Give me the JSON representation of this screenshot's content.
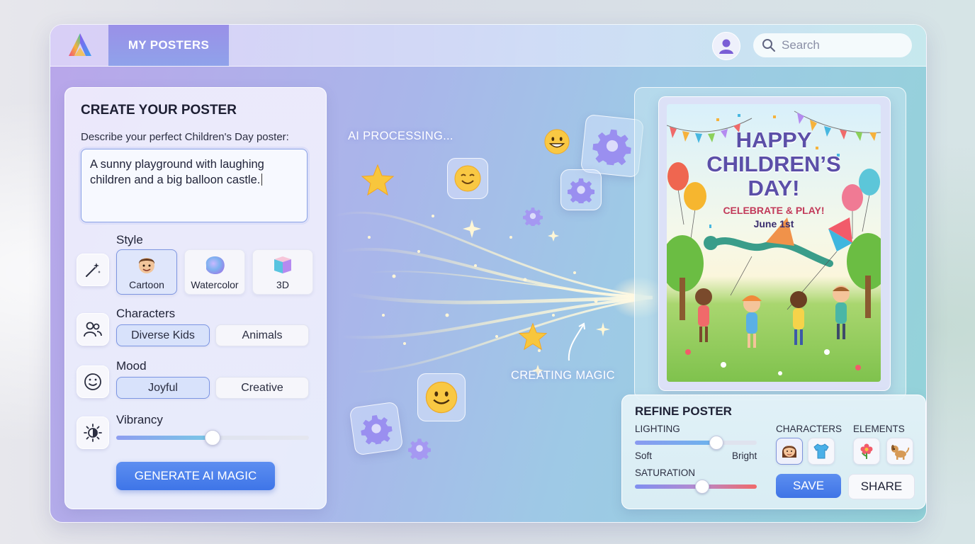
{
  "topbar": {
    "tab_label": "MY POSTERS",
    "search_placeholder": "Search"
  },
  "create": {
    "title": "CREATE YOUR POSTER",
    "describe_label": "Describe your perfect Children's Day poster:",
    "prompt_text": "A sunny playground with laughing children and a big balloon castle.",
    "style": {
      "label": "Style",
      "options": [
        "Cartoon",
        "Watercolor",
        "3D"
      ],
      "selected": "Cartoon"
    },
    "characters": {
      "label": "Characters",
      "options": [
        "Diverse Kids",
        "Animals"
      ],
      "selected": "Diverse Kids"
    },
    "mood": {
      "label": "Mood",
      "options": [
        "Joyful",
        "Creative"
      ],
      "selected": "Joyful"
    },
    "vibrancy": {
      "label": "Vibrancy",
      "value_fraction": 0.5
    },
    "generate_label": "GENERATE AI MAGIC"
  },
  "middle": {
    "processing_text": "AI PROCESSING...",
    "creating_text": "CREATING MAGIC"
  },
  "poster": {
    "headline": [
      "HAPPY",
      "CHILDREN’S",
      "DAY!"
    ],
    "subline": "CELEBRATE & PLAY!",
    "date": "June 1st"
  },
  "refine": {
    "title": "REFINE POSTER",
    "lighting": {
      "label": "LIGHTING",
      "min_label": "Soft",
      "max_label": "Bright",
      "value_fraction": 0.67
    },
    "saturation": {
      "label": "SATURATION",
      "value_fraction": 0.55
    },
    "characters_label": "CHARACTERS",
    "elements_label": "ELEMENTS",
    "save_label": "SAVE",
    "share_label": "SHARE"
  },
  "colors": {
    "accent_blue": "#3e75e8",
    "poster_title": "#5b4fa8",
    "poster_subline": "#c23a5a"
  }
}
